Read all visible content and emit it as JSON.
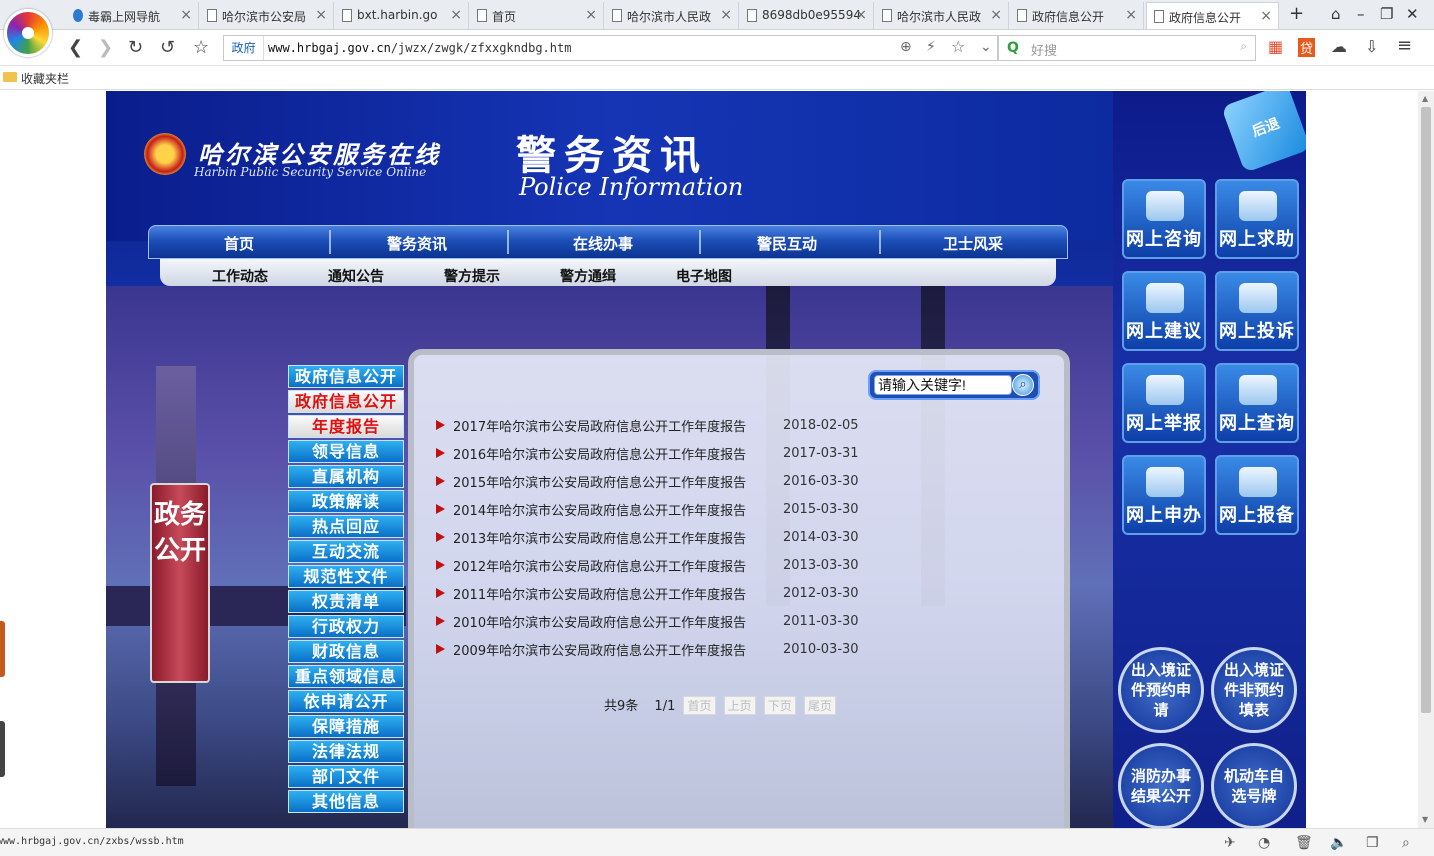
{
  "browser": {
    "tabs": [
      {
        "label": "毒霸上网导航",
        "active": false
      },
      {
        "label": "哈尔滨市公安局",
        "active": false
      },
      {
        "label": "bxt.harbin.go",
        "active": false
      },
      {
        "label": "首页",
        "active": false
      },
      {
        "label": "哈尔滨市人民政",
        "active": false
      },
      {
        "label": "8698db0e95594",
        "active": false
      },
      {
        "label": "哈尔滨市人民政",
        "active": false
      },
      {
        "label": "政府信息公开",
        "active": false
      },
      {
        "label": "政府信息公开",
        "active": true
      }
    ],
    "close_glyph": "×",
    "new_tab_glyph": "+",
    "url_badge": "政府",
    "url_domain": "www.hrbgaj.gov.cn",
    "url_path": "/jwzx/zwgk/zfxxgkndbg.htm",
    "search_placeholder": "好搜",
    "bookmark_folder": "收藏夹栏",
    "status_url": "www.hrbgaj.gov.cn/zxbs/wssb.htm"
  },
  "site": {
    "title": "哈尔滨公安服务在线",
    "subtitle": "Harbin Public Security Service Online",
    "section_title": "警务资讯",
    "section_subtitle": "Police Information",
    "main_nav": [
      "首页",
      "警务资讯",
      "在线办事",
      "警民互动",
      "卫士风采"
    ],
    "sub_nav": [
      "工作动态",
      "通知公告",
      "警方提示",
      "警方通缉",
      "电子地图"
    ],
    "side_label": "政务公开",
    "left_menu": [
      {
        "label": "政府信息公开",
        "active": false
      },
      {
        "label": "政府信息公开",
        "active": true
      },
      {
        "label": "年度报告",
        "active": true
      },
      {
        "label": "领导信息",
        "active": false
      },
      {
        "label": "直属机构",
        "active": false
      },
      {
        "label": "政策解读",
        "active": false
      },
      {
        "label": "热点回应",
        "active": false
      },
      {
        "label": "互动交流",
        "active": false
      },
      {
        "label": "规范性文件",
        "active": false
      },
      {
        "label": "权责清单",
        "active": false
      },
      {
        "label": "行政权力",
        "active": false
      },
      {
        "label": "财政信息",
        "active": false
      },
      {
        "label": "重点领域信息",
        "active": false
      },
      {
        "label": "依申请公开",
        "active": false
      },
      {
        "label": "保障措施",
        "active": false
      },
      {
        "label": "法律法规",
        "active": false
      },
      {
        "label": "部门文件",
        "active": false
      },
      {
        "label": "其他信息",
        "active": false
      }
    ],
    "search_value": "请输入关键字!",
    "reports": [
      {
        "title": "2017年哈尔滨市公安局政府信息公开工作年度报告",
        "date": "2018-02-05"
      },
      {
        "title": "2016年哈尔滨市公安局政府信息公开工作年度报告",
        "date": "2017-03-31"
      },
      {
        "title": "2015年哈尔滨市公安局政府信息公开工作年度报告",
        "date": "2016-03-30"
      },
      {
        "title": "2014年哈尔滨市公安局政府信息公开工作年度报告",
        "date": "2015-03-30"
      },
      {
        "title": "2013年哈尔滨市公安局政府信息公开工作年度报告",
        "date": "2014-03-30"
      },
      {
        "title": "2012年哈尔滨市公安局政府信息公开工作年度报告",
        "date": "2013-03-30"
      },
      {
        "title": "2011年哈尔滨市公安局政府信息公开工作年度报告",
        "date": "2012-03-30"
      },
      {
        "title": "2010年哈尔滨市公安局政府信息公开工作年度报告",
        "date": "2011-03-30"
      },
      {
        "title": "2009年哈尔滨市公安局政府信息公开工作年度报告",
        "date": "2010-03-30"
      }
    ],
    "pager": {
      "total": "共9条",
      "page": "1/1",
      "first": "首页",
      "prev": "上页",
      "next": "下页",
      "last": "尾页"
    },
    "back_label": "后退",
    "services": [
      "网上咨询",
      "网上求助",
      "网上建议",
      "网上投诉",
      "网上举报",
      "网上查询",
      "网上申办",
      "网上报备"
    ],
    "circle_buttons": [
      "出入境证件预约申请",
      "出入境证件非预约填表",
      "消防办事结果公开",
      "机动车自选号牌"
    ]
  }
}
